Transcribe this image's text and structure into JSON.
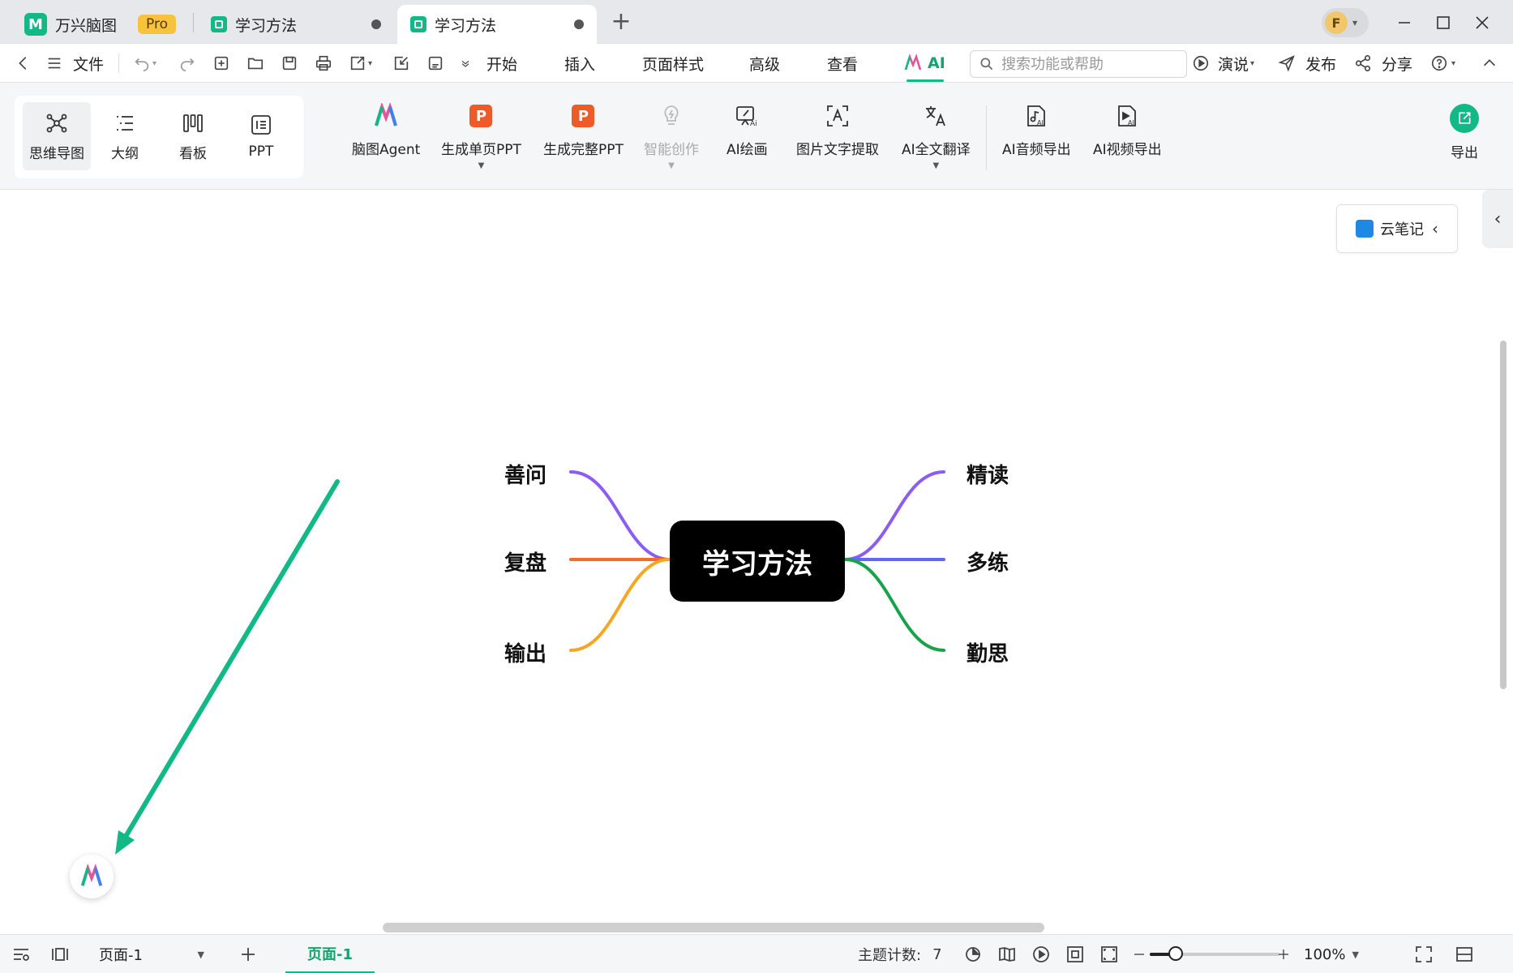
{
  "app": {
    "home_tab": "万兴脑图",
    "pro_badge": "Pro",
    "tabs": [
      {
        "label": "学习方法"
      },
      {
        "label": "学习方法"
      }
    ],
    "avatar_letter": "F"
  },
  "menubar": {
    "file": "文件",
    "menus": [
      "开始",
      "插入",
      "页面样式",
      "高级",
      "查看"
    ],
    "ai_tab": "AI",
    "search_placeholder": "搜索功能或帮助",
    "present": "演说",
    "publish": "发布",
    "share": "分享"
  },
  "ribbon": {
    "views": [
      "思维导图",
      "大纲",
      "看板",
      "PPT"
    ],
    "tools": [
      {
        "label": "脑图Agent"
      },
      {
        "label": "生成单页PPT"
      },
      {
        "label": "生成完整PPT"
      },
      {
        "label": "智能创作"
      },
      {
        "label": "AI绘画"
      },
      {
        "label": "图片文字提取"
      },
      {
        "label": "AI全文翻译"
      },
      {
        "label": "AI音频导出"
      },
      {
        "label": "AI视频导出"
      }
    ],
    "export": "导出"
  },
  "canvas": {
    "cloud_note": "云笔记",
    "central_topic": "学习方法",
    "left_topics": [
      "善问",
      "复盘",
      "输出"
    ],
    "right_topics": [
      "精读",
      "多练",
      "勤思"
    ],
    "branch_colors": {
      "善问": "#8b5cf6",
      "复盘": "#f26b2a",
      "输出": "#f5a623",
      "精读": "#8b5cf6",
      "多练": "#6366f1",
      "勤思": "#16a34a"
    },
    "annotation_arrow_color": "#12b886"
  },
  "statusbar": {
    "page_select": "页面-1",
    "page_tab": "页面-1",
    "topic_count_label": "主题计数:",
    "topic_count_value": "7",
    "zoom_level": "100%",
    "zoom_fraction": 0.2
  },
  "colors": {
    "accent": "#12b886",
    "ppt_orange": "#f05a28",
    "pro_yellow": "#f8c33c"
  }
}
